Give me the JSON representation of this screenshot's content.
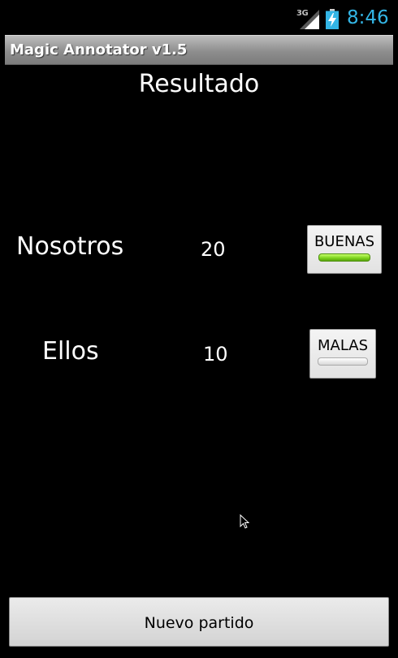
{
  "status_bar": {
    "network": "3G",
    "time": "8:46",
    "icons": [
      "signal-icon",
      "battery-charging-icon"
    ],
    "time_color": "#33b5e5"
  },
  "app": {
    "title": "Magic Annotator v1.5"
  },
  "main": {
    "heading": "Resultado",
    "rows": [
      {
        "team": "Nosotros",
        "score": "20",
        "button": "BUENAS",
        "indicator": "on"
      },
      {
        "team": "Ellos",
        "score": "10",
        "button": "MALAS",
        "indicator": "off"
      }
    ],
    "new_game_label": "Nuevo partido"
  },
  "colors": {
    "background": "#000000",
    "indicator_on": "#7ad11c",
    "indicator_off": "#e0e0e0"
  }
}
